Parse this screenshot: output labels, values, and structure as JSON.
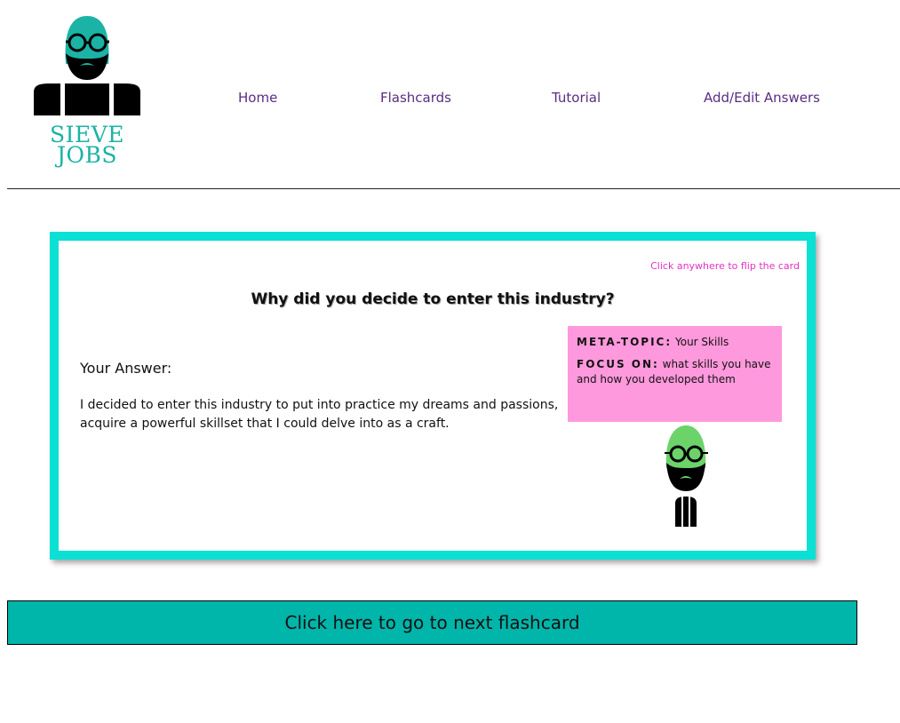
{
  "logo": {
    "line1": "SIEVE",
    "line2": "JOBS"
  },
  "nav": [
    {
      "label": "Home"
    },
    {
      "label": "Flashcards"
    },
    {
      "label": "Tutorial"
    },
    {
      "label": "Add/Edit Answers"
    }
  ],
  "card": {
    "flip_hint": "Click anywhere to flip the card",
    "question": "Why did you decide to enter this industry?",
    "answer_label": "Your Answer:",
    "answer_text": "I decided to enter this industry to put into practice my dreams and passions, acquire a powerful skillset that I could delve into as a craft.",
    "meta": {
      "topic_key": "META-TOPIC:",
      "topic_value": "Your Skills",
      "focus_key": "FOCUS ON:",
      "focus_value": "what skills you have and how you developed them"
    }
  },
  "next_button": {
    "label": "Click here to go to next flashcard"
  },
  "colors": {
    "teal": "#1ab3a6",
    "card_border": "#0be0d4",
    "button": "#00b5aa",
    "nav_link": "#5a2d82",
    "meta_bg": "#ff99dd",
    "hint": "#e52fc4",
    "mascot_head": "#6cd26a"
  }
}
